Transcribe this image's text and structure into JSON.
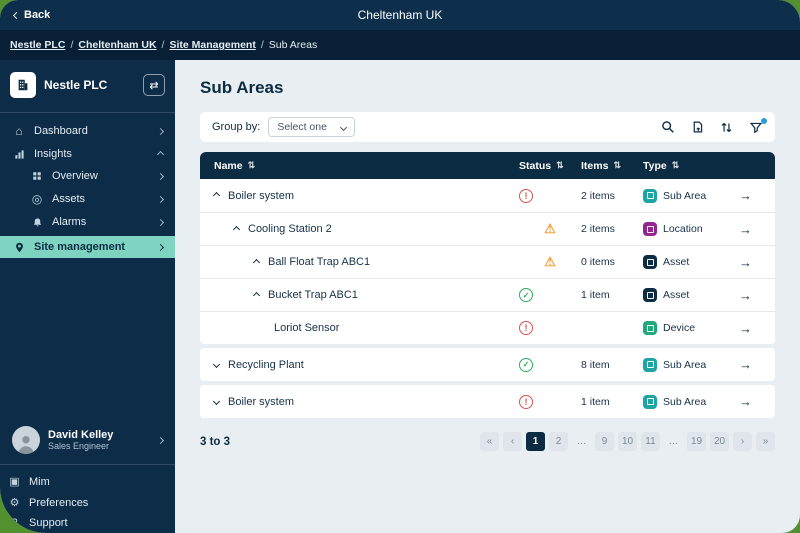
{
  "topbar": {
    "back_label": "Back",
    "title": "Cheltenham UK"
  },
  "breadcrumb": {
    "separator": "/",
    "links": [
      "Nestle PLC",
      "Cheltenham UK",
      "Site Management"
    ],
    "current": "Sub Areas"
  },
  "sidebar": {
    "org_name": "Nestle PLC",
    "items": [
      {
        "label": "Dashboard"
      },
      {
        "label": "Insights"
      },
      {
        "label": "Overview"
      },
      {
        "label": "Assets"
      },
      {
        "label": "Alarms"
      },
      {
        "label": "Site management"
      }
    ],
    "user": {
      "name": "David Kelley",
      "role": "Sales Engineer"
    },
    "footer_items": [
      {
        "label": "Mim"
      },
      {
        "label": "Preferences"
      },
      {
        "label": "Support"
      }
    ]
  },
  "main": {
    "title": "Sub Areas",
    "toolbar": {
      "group_by_label": "Group by:",
      "group_by_value": "Select one"
    },
    "table": {
      "columns": [
        "Name",
        "Status",
        "Items",
        "Type"
      ],
      "rows": [
        {
          "name": "Boiler system",
          "status": "error",
          "items": "2 items",
          "type": "Sub Area"
        },
        {
          "name": "Cooling Station 2",
          "status": "warning",
          "items": "2 items",
          "type": "Location"
        },
        {
          "name": "Ball Float Trap ABC1",
          "status": "warning",
          "items": "0 items",
          "type": "Asset"
        },
        {
          "name": "Bucket Trap ABC1",
          "status": "ok",
          "items": "1 item",
          "type": "Asset"
        },
        {
          "name": "Loriot Sensor",
          "status": "error",
          "items": "",
          "type": "Device"
        },
        {
          "name": "Recycling Plant",
          "status": "ok",
          "items": "8 item",
          "type": "Sub Area"
        },
        {
          "name": "Boiler system",
          "status": "error",
          "items": "1 item",
          "type": "Sub Area"
        }
      ]
    },
    "footer": {
      "range": "3 to 3",
      "pages": [
        "«",
        "‹",
        "1",
        "2",
        "…",
        "9",
        "10",
        "11",
        "…",
        "19",
        "20",
        "›",
        "»"
      ],
      "active_page": "1"
    }
  },
  "colors": {
    "navy": "#0C2C44",
    "active_teal": "#7ED4C0",
    "error_red": "#D9534F",
    "warn_orange": "#F0A33C",
    "ok_green": "#2FA85C",
    "subarea_teal": "#1FA3A3",
    "location_purple": "#93278F",
    "asset_navy": "#0C2C44",
    "device_green": "#1FA97D",
    "filter_dot_blue": "#2D9CDB"
  }
}
